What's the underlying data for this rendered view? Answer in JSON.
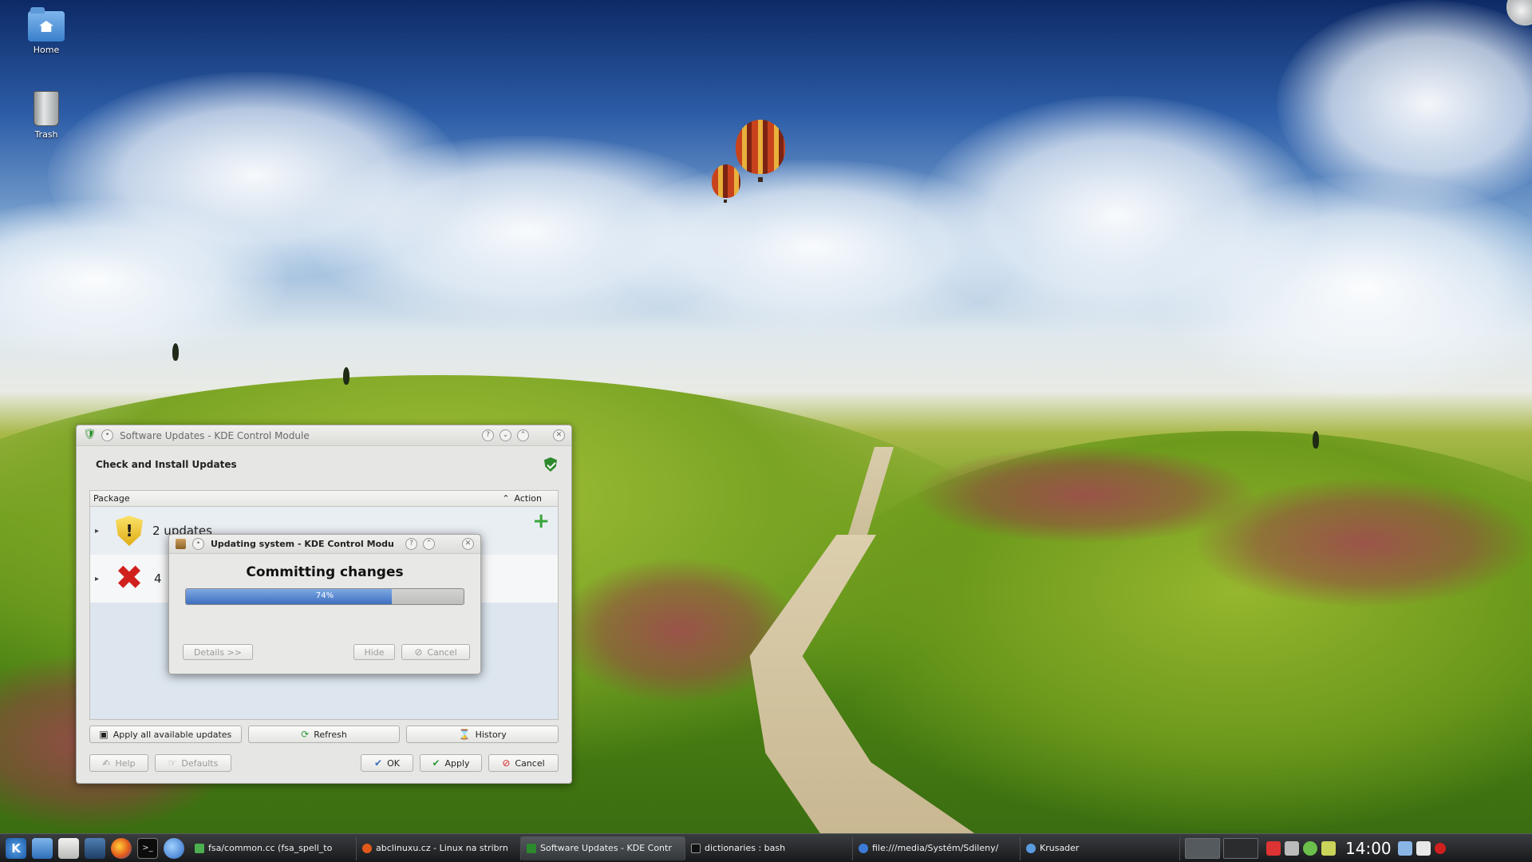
{
  "desktop": {
    "icons": [
      {
        "label": "Home",
        "icon": "home-folder-icon"
      },
      {
        "label": "Trash",
        "icon": "trash-icon"
      }
    ]
  },
  "main_window": {
    "title": "Software Updates - KDE Control Module",
    "module_title": "Check and Install Updates",
    "columns": {
      "package": "Package",
      "action": "Action"
    },
    "rows": [
      {
        "text": "2 updates",
        "icon": "warning-shield-icon"
      },
      {
        "text": "4 ",
        "icon": "error-x-icon"
      }
    ],
    "buttons": {
      "apply_all": "Apply all available updates",
      "refresh": "Refresh",
      "history": "History",
      "help": "Help",
      "defaults": "Defaults",
      "ok": "OK",
      "apply": "Apply",
      "cancel": "Cancel"
    }
  },
  "progress_dialog": {
    "title": "Updating system - KDE Control Modu",
    "heading": "Committing changes",
    "progress": 0.74,
    "progress_label": "74%",
    "buttons": {
      "details": "Details >>",
      "hide": "Hide",
      "cancel": "Cancel"
    }
  },
  "taskbar": {
    "tasks": [
      {
        "label": "fsa/common.cc (fsa_spell_to"
      },
      {
        "label": "abclinuxu.cz - Linux na stribrn"
      },
      {
        "label": "Software Updates - KDE Contr",
        "active": true
      },
      {
        "label": "dictionaries : bash"
      },
      {
        "label": "file:///media/Systém/Sdileny/"
      },
      {
        "label": "Krusader"
      }
    ],
    "clock": "14:00"
  }
}
